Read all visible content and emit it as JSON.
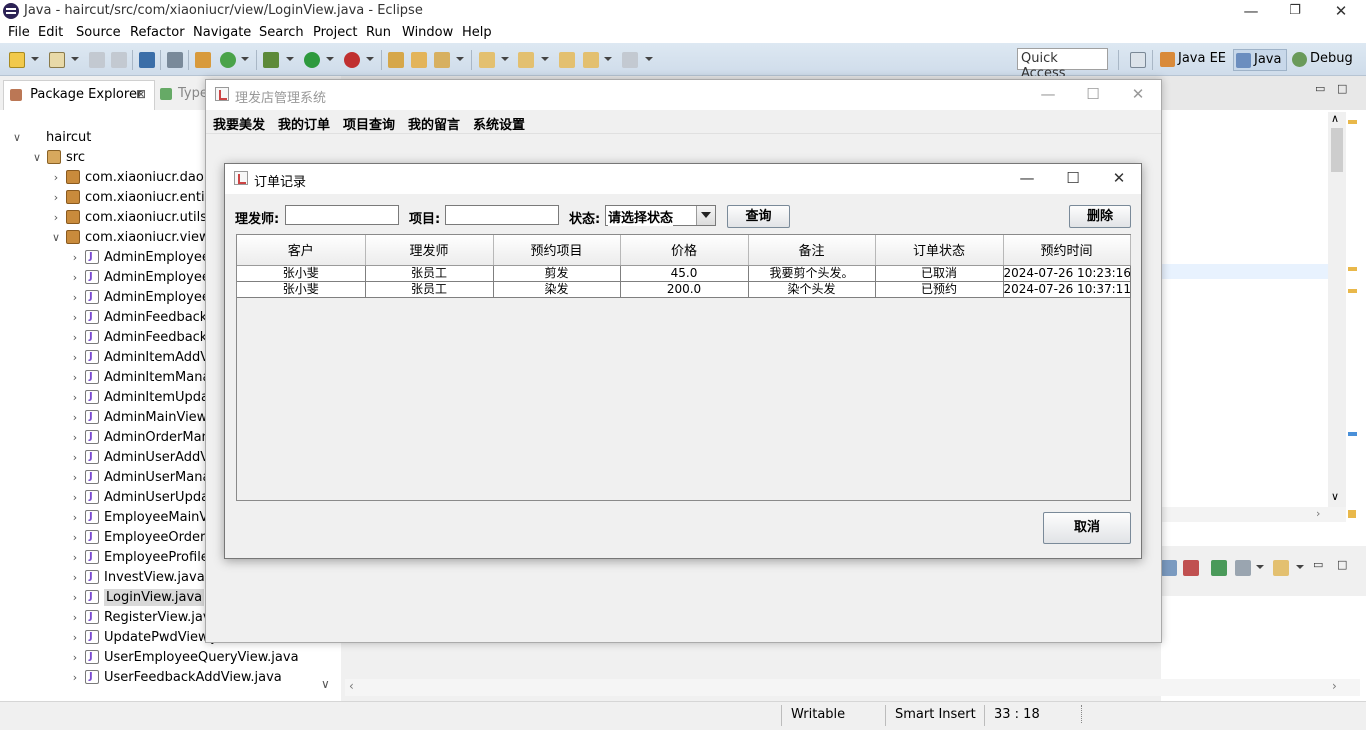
{
  "eclipse": {
    "window_title": "Java - haircut/src/com/xiaoniucr/view/LoginView.java - Eclipse",
    "minimize": "—",
    "restore": "❐",
    "close": "✕",
    "menu": [
      "File",
      "Edit",
      "Source",
      "Refactor",
      "Navigate",
      "Search",
      "Project",
      "Run",
      "Window",
      "Help"
    ],
    "quick_access": "Quick Access",
    "perspectives": [
      {
        "label": "Java EE",
        "icon": "java-ee-perspective-icon"
      },
      {
        "label": "Java",
        "icon": "java-perspective-icon",
        "active": true
      },
      {
        "label": "Debug",
        "icon": "debug-perspective-icon"
      }
    ]
  },
  "package_explorer": {
    "tab_label": "Package Explorer",
    "tab_close": "⊠",
    "type_tab_label": "Type",
    "tree": [
      {
        "label": "haircut",
        "icon": "project",
        "twisty": "∨"
      },
      {
        "label": "src",
        "icon": "src",
        "twisty": "∨"
      },
      {
        "label": "com.xiaoniucr.dao",
        "icon": "pkg",
        "twisty": "›"
      },
      {
        "label": "com.xiaoniucr.entity",
        "icon": "pkg",
        "twisty": "›"
      },
      {
        "label": "com.xiaoniucr.utils",
        "icon": "pkg",
        "twisty": "›"
      },
      {
        "label": "com.xiaoniucr.view",
        "icon": "pkg",
        "twisty": "∨"
      },
      {
        "label": "AdminEmployeeA",
        "icon": "java",
        "twisty": "›"
      },
      {
        "label": "AdminEmployeeM",
        "icon": "java",
        "twisty": "›"
      },
      {
        "label": "AdminEmployeeU",
        "icon": "java",
        "twisty": "›"
      },
      {
        "label": "AdminFeedbackM",
        "icon": "java",
        "twisty": "›"
      },
      {
        "label": "AdminFeedbackR",
        "icon": "java",
        "twisty": "›"
      },
      {
        "label": "AdminItemAddVi",
        "icon": "java",
        "twisty": "›"
      },
      {
        "label": "AdminItemManag",
        "icon": "java",
        "twisty": "›"
      },
      {
        "label": "AdminItemUpdat",
        "icon": "java",
        "twisty": "›"
      },
      {
        "label": "AdminMainView.j",
        "icon": "java",
        "twisty": "›"
      },
      {
        "label": "AdminOrderMana",
        "icon": "java",
        "twisty": "›"
      },
      {
        "label": "AdminUserAddVi",
        "icon": "java",
        "twisty": "›"
      },
      {
        "label": "AdminUserManag",
        "icon": "java",
        "twisty": "›"
      },
      {
        "label": "AdminUserUpdat",
        "icon": "java",
        "twisty": "›"
      },
      {
        "label": "EmployeeMainVie",
        "icon": "java",
        "twisty": "›"
      },
      {
        "label": "EmployeeOrderM",
        "icon": "java",
        "twisty": "›"
      },
      {
        "label": "EmployeeProfileV",
        "icon": "java",
        "twisty": "›"
      },
      {
        "label": "InvestView.java",
        "icon": "java",
        "twisty": "›"
      },
      {
        "label": "LoginView.java",
        "icon": "java",
        "twisty": "›",
        "selected": true
      },
      {
        "label": "RegisterView.java",
        "icon": "java",
        "twisty": "›"
      },
      {
        "label": "UpdatePwdView.java",
        "icon": "java",
        "twisty": "›"
      },
      {
        "label": "UserEmployeeQueryView.java",
        "icon": "java",
        "twisty": "›"
      },
      {
        "label": "UserFeedbackAddView.java",
        "icon": "java",
        "twisty": "›"
      }
    ],
    "scroll_down": "∨"
  },
  "status_bar": {
    "writable": "Writable",
    "insert_mode": "Smart Insert",
    "cursor": "33 : 18"
  },
  "main_frame": {
    "title": "理发店管理系统",
    "menu": [
      "我要美发",
      "我的订单",
      "项目查询",
      "我的留言",
      "系统设置"
    ]
  },
  "order_dialog": {
    "title": "订单记录",
    "barber_label": "理发师:",
    "barber_value": "",
    "item_label": "项目:",
    "item_value": "",
    "status_label": "状态:",
    "status_selected": "请选择状态",
    "query_button": "查询",
    "delete_button": "删除",
    "cancel_button": "取消",
    "table": {
      "headers": [
        "客户",
        "理发师",
        "预约项目",
        "价格",
        "备注",
        "订单状态",
        "预约时间"
      ],
      "rows": [
        [
          "张小斐",
          "张员工",
          "剪发",
          "45.0",
          "我要剪个头发。",
          "已取消",
          "2024-07-26 10:23:16"
        ],
        [
          "张小斐",
          "张员工",
          "染发",
          "200.0",
          "染个头发",
          "已预约",
          "2024-07-26 10:37:11"
        ]
      ]
    }
  }
}
